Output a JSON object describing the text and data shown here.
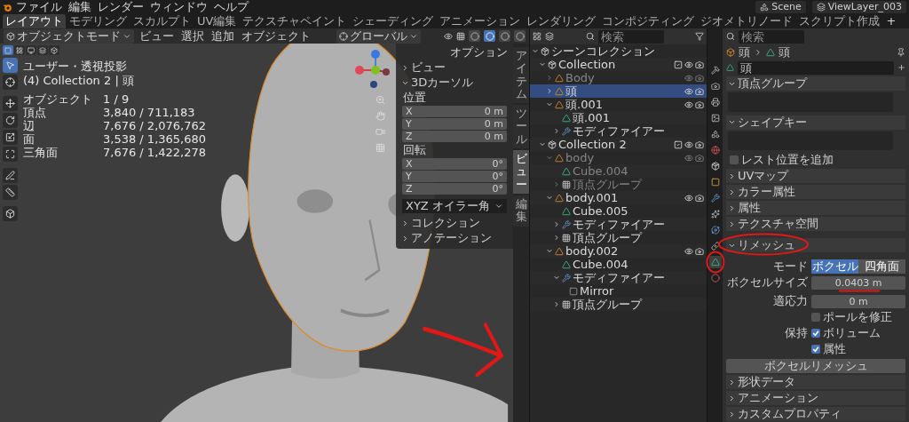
{
  "menu_bar": {
    "menus": [
      "ファイル",
      "編集",
      "レンダー",
      "ウィンドウ",
      "ヘルプ"
    ],
    "workspaces": [
      {
        "label": "レイアウト",
        "selected": true
      },
      {
        "label": "モデリング",
        "selected": false
      },
      {
        "label": "スカルプト",
        "selected": false
      },
      {
        "label": "UV編集",
        "selected": false
      },
      {
        "label": "テクスチャペイント",
        "selected": false
      },
      {
        "label": "シェーディング",
        "selected": false
      },
      {
        "label": "アニメーション",
        "selected": false
      },
      {
        "label": "レンダリング",
        "selected": false
      },
      {
        "label": "コンポジティング",
        "selected": false
      },
      {
        "label": "ジオメトリノード",
        "selected": false
      },
      {
        "label": "スクリプト作成",
        "selected": false
      }
    ],
    "add_tab": "+",
    "scene": "Scene",
    "view_layer": "ViewLayer_003"
  },
  "viewport": {
    "header": {
      "mode": "オブジェクトモード",
      "menus": [
        "ビュー",
        "選択",
        "追加",
        "オブジェクト"
      ],
      "orientation": "グローバル",
      "options": "オプション",
      "shading": [
        {
          "selected": false
        },
        {
          "selected": true
        },
        {
          "selected": false
        },
        {
          "selected": false
        }
      ]
    },
    "select_modes": [
      {
        "selected": true
      },
      {
        "selected": false
      },
      {
        "selected": false
      },
      {
        "selected": false
      },
      {
        "selected": false
      }
    ],
    "tools": [
      {
        "kind": "select",
        "selected": true
      },
      {
        "kind": "cursor",
        "selected": false
      },
      {
        "kind": "move",
        "selected": false
      },
      {
        "kind": "rotate",
        "selected": false
      },
      {
        "kind": "scale",
        "selected": false
      },
      {
        "kind": "transform",
        "selected": false
      },
      {
        "kind": "annotate",
        "selected": false
      },
      {
        "kind": "measure",
        "selected": false
      },
      {
        "kind": "add_cube",
        "selected": false
      }
    ],
    "overlay": {
      "view": "ユーザー・透視投影",
      "context": "(4) Collection 2 | 頭",
      "stats": [
        {
          "label": "オブジェクト",
          "value": "1 / 9"
        },
        {
          "label": "頂点",
          "value": "3,840 / 711,183"
        },
        {
          "label": "辺",
          "value": "7,676 / 2,076,762"
        },
        {
          "label": "面",
          "value": "3,538 / 1,365,680"
        },
        {
          "label": "三角面",
          "value": "7,676 / 1,422,278"
        }
      ]
    },
    "sidebar": {
      "tabs": [
        {
          "label": "アイテム",
          "selected": false
        },
        {
          "label": "ツール",
          "selected": false
        },
        {
          "label": "ビュー",
          "selected": true
        },
        {
          "label": "編集",
          "selected": false
        }
      ],
      "sections": [
        {
          "title": "ビュー",
          "expanded": false
        },
        {
          "title": "3Dカーソル",
          "expanded": true,
          "groups": [
            {
              "label": "位置",
              "fields": [
                {
                  "axis": "X",
                  "value": "0 m"
                },
                {
                  "axis": "Y",
                  "value": "0 m"
                },
                {
                  "axis": "Z",
                  "value": "0 m"
                }
              ]
            },
            {
              "label": "回転",
              "fields": [
                {
                  "axis": "X",
                  "value": "0°"
                },
                {
                  "axis": "Y",
                  "value": "0°"
                },
                {
                  "axis": "Z",
                  "value": "0°"
                }
              ]
            }
          ],
          "rotation_mode": "XYZ オイラー角"
        },
        {
          "title": "コレクション",
          "expanded": false
        },
        {
          "title": "アノテーション",
          "expanded": false
        }
      ]
    }
  },
  "outliner": {
    "search": {
      "placeholder": "検索"
    },
    "tree": [
      {
        "kind": "scene",
        "label": "シーンコレクション",
        "expanded": true,
        "selected": false,
        "disabled": false,
        "children": [
          {
            "kind": "collection",
            "label": "Collection",
            "expanded": true,
            "checked": true,
            "selected": false,
            "disabled": false,
            "children": [
              {
                "kind": "object",
                "label": "Body",
                "expanded": false,
                "selected": false,
                "disabled": true
              },
              {
                "kind": "object",
                "label": "頭",
                "expanded": false,
                "selected": true,
                "disabled": false
              },
              {
                "kind": "object",
                "label": "頭.001",
                "expanded": true,
                "selected": false,
                "disabled": false,
                "children": [
                  {
                    "kind": "mesh",
                    "label": "頭.001",
                    "selected": false,
                    "disabled": false
                  },
                  {
                    "kind": "modifier",
                    "label": "モディファイアー",
                    "expanded": false,
                    "selected": false,
                    "disabled": false
                  }
                ]
              }
            ]
          },
          {
            "kind": "collection",
            "label": "Collection 2",
            "expanded": true,
            "checked": true,
            "selected": false,
            "disabled": false,
            "children": [
              {
                "kind": "object",
                "label": "body",
                "expanded": true,
                "selected": false,
                "disabled": true,
                "children": [
                  {
                    "kind": "mesh",
                    "label": "Cube.004",
                    "selected": false,
                    "disabled": true
                  },
                  {
                    "kind": "vgroup",
                    "label": "頂点グループ",
                    "expanded": false,
                    "selected": false,
                    "disabled": true
                  }
                ]
              },
              {
                "kind": "object",
                "label": "body.001",
                "expanded": true,
                "selected": false,
                "disabled": false,
                "children": [
                  {
                    "kind": "mesh",
                    "label": "Cube.005",
                    "selected": false,
                    "disabled": false
                  },
                  {
                    "kind": "modifier",
                    "label": "モディファイアー",
                    "expanded": false,
                    "selected": false,
                    "disabled": false
                  },
                  {
                    "kind": "vgroup",
                    "label": "頂点グループ",
                    "expanded": false,
                    "selected": false,
                    "disabled": false
                  }
                ]
              },
              {
                "kind": "object",
                "label": "body.002",
                "expanded": true,
                "selected": false,
                "disabled": false,
                "children": [
                  {
                    "kind": "mesh",
                    "label": "Cube.004",
                    "selected": false,
                    "disabled": false
                  },
                  {
                    "kind": "modifier",
                    "label": "モディファイアー",
                    "expanded": true,
                    "selected": false,
                    "disabled": false,
                    "children": [
                      {
                        "kind": "mirror",
                        "label": "Mirror",
                        "selected": false,
                        "disabled": false
                      }
                    ]
                  },
                  {
                    "kind": "vgroup",
                    "label": "頂点グループ",
                    "expanded": false,
                    "selected": false,
                    "disabled": false
                  }
                ]
              }
            ]
          }
        ]
      }
    ]
  },
  "properties": {
    "search": {
      "placeholder": "検索"
    },
    "tabs": [
      {
        "kind": "tool",
        "selected": false
      },
      {
        "kind": "render",
        "selected": false
      },
      {
        "kind": "output",
        "selected": false
      },
      {
        "kind": "view_layer",
        "selected": false
      },
      {
        "kind": "scene",
        "selected": false
      },
      {
        "kind": "world",
        "selected": false
      },
      {
        "kind": "collection",
        "selected": false
      },
      {
        "kind": "object",
        "selected": false
      },
      {
        "kind": "modifier",
        "selected": false
      },
      {
        "kind": "particles",
        "selected": false
      },
      {
        "kind": "physics",
        "selected": false
      },
      {
        "kind": "constraints",
        "selected": false
      },
      {
        "kind": "data",
        "selected": true
      },
      {
        "kind": "material",
        "selected": false
      }
    ],
    "breadcrumb": [
      "頭",
      "頭"
    ],
    "datablock": "頭",
    "panels": [
      {
        "kind": "list",
        "title": "頂点グループ",
        "expanded": true
      },
      {
        "kind": "list",
        "title": "シェイプキー",
        "expanded": true
      },
      {
        "kind": "checkbox",
        "label": "レスト位置を追加",
        "checked": false
      },
      {
        "kind": "panel",
        "title": "UVマップ",
        "expanded": false
      },
      {
        "kind": "panel",
        "title": "カラー属性",
        "expanded": false
      },
      {
        "kind": "panel",
        "title": "属性",
        "expanded": false
      },
      {
        "kind": "panel",
        "title": "テクスチャ空間",
        "expanded": false
      },
      {
        "kind": "remesh",
        "title": "リメッシュ",
        "expanded": true,
        "mode_label": "モード",
        "modes": [
          {
            "label": "ボクセル",
            "selected": true
          },
          {
            "label": "四角面",
            "selected": false
          }
        ],
        "voxel_size": {
          "label": "ボクセルサイズ",
          "value": "0.0403 m"
        },
        "adaptivity": {
          "label": "適応力",
          "value": "0 m"
        },
        "fix_poles": {
          "label": "ポールを修正",
          "checked": false
        },
        "preserve_label": "保持",
        "preserve": [
          {
            "label": "ボリューム",
            "checked": true
          },
          {
            "label": "属性",
            "checked": true
          }
        ],
        "button": "ボクセルリメッシュ"
      },
      {
        "kind": "panel",
        "title": "形状データ",
        "expanded": false
      },
      {
        "kind": "panel",
        "title": "アニメーション",
        "expanded": false
      },
      {
        "kind": "panel",
        "title": "カスタムプロパティ",
        "expanded": false
      }
    ]
  }
}
